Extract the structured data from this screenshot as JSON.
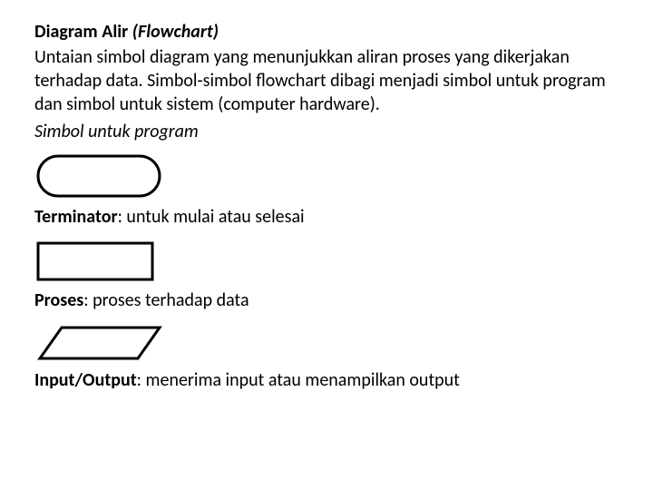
{
  "title_plain": "Diagram Alir ",
  "title_ital": "(Flowchart)",
  "description": "Untaian simbol diagram yang menunjukkan aliran  proses yang dikerjakan terhadap data.  Simbol-simbol flowchart dibagi menjadi simbol untuk program dan simbol untuk sistem (computer hardware).",
  "subhead": "Simbol untuk program",
  "symbols": [
    {
      "name_bold": "Terminator",
      "name_rest": ": untuk mulai atau selesai"
    },
    {
      "name_bold": "Proses",
      "name_rest": ": proses terhadap data"
    },
    {
      "name_bold": "Input/Output",
      "name_rest": ": menerima input atau menampilkan output"
    }
  ]
}
